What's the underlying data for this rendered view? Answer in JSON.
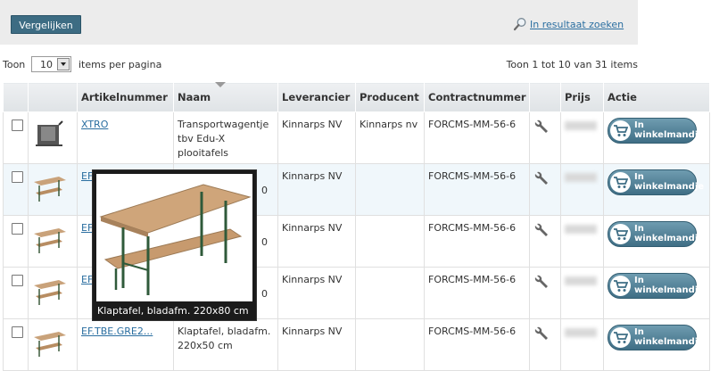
{
  "toolbar": {
    "compare_label": "Vergelijken",
    "search_label": "In resultaat zoeken"
  },
  "pager": {
    "show_label": "Toon",
    "per_page_value": "10",
    "per_page_label": "items per pagina",
    "count_label": "Toon 1 tot 10 van 31 items"
  },
  "table": {
    "headers": [
      "Artikelnummer",
      "Naam",
      "Leverancier",
      "Producent",
      "Contractnummer",
      "Prijs",
      "Actie"
    ],
    "rows": [
      {
        "sku": "XTRO",
        "name": "Transportwagentje tbv Edu-X plooitafels",
        "supplier": "Kinnarps NV",
        "producer": "Kinnarps nv",
        "contract": "FORCMS-MM-56-6"
      },
      {
        "sku": "EF...",
        "name": "0",
        "supplier": "Kinnarps NV",
        "producer": "",
        "contract": "FORCMS-MM-56-6"
      },
      {
        "sku": "EF",
        "name": "0",
        "supplier": "Kinnarps NV",
        "producer": "",
        "contract": "FORCMS-MM-56-6"
      },
      {
        "sku": "EF",
        "name": "0",
        "supplier": "Kinnarps NV",
        "producer": "",
        "contract": "FORCMS-MM-56-6"
      },
      {
        "sku": "EF.TBE.GRE2...",
        "name": "Klaptafel, bladafm. 220x50 cm",
        "supplier": "Kinnarps NV",
        "producer": "",
        "contract": "FORCMS-MM-56-6"
      }
    ],
    "cart_label_1": "In",
    "cart_label_2": "winkelmandje"
  },
  "popup": {
    "caption": "Klaptafel, bladafm. 220x80 cm"
  },
  "colors": {
    "accent": "#3d6c83",
    "link": "#2a6ea0"
  }
}
